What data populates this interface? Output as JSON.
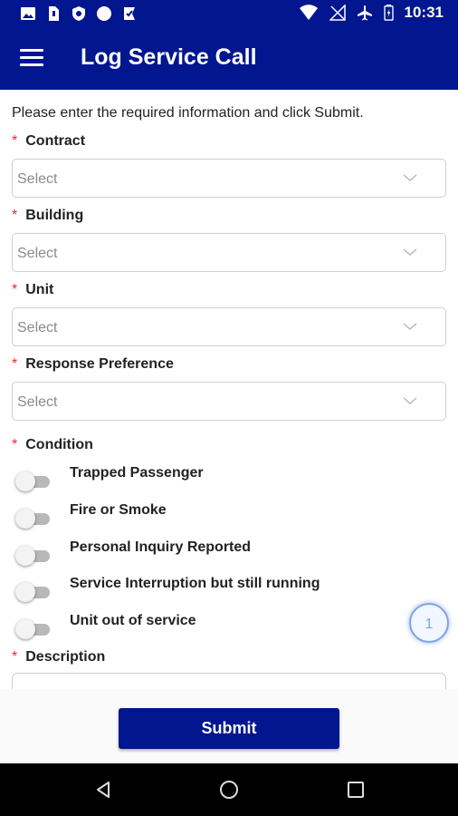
{
  "status_bar": {
    "time": "10:31",
    "left_icons": [
      "image-icon",
      "sim-icon",
      "shield-icon",
      "circle-icon",
      "check-flag-icon"
    ],
    "right_icons": [
      "wifi-icon",
      "signal-off-icon",
      "airplane-icon",
      "battery-icon"
    ]
  },
  "app_bar": {
    "menu_icon": "hamburger-menu-icon",
    "title": "Log Service Call"
  },
  "form": {
    "instruction": "Please enter the required information and click Submit.",
    "required_marker": "*",
    "fields": [
      {
        "label": "Contract",
        "placeholder": "Select"
      },
      {
        "label": "Building",
        "placeholder": "Select"
      },
      {
        "label": "Unit",
        "placeholder": "Select"
      },
      {
        "label": "Response Preference",
        "placeholder": "Select"
      }
    ],
    "condition": {
      "label": "Condition",
      "options": [
        {
          "label": "Trapped Passenger",
          "on": false
        },
        {
          "label": "Fire or Smoke",
          "on": false
        },
        {
          "label": "Personal Inquiry Reported",
          "on": false
        },
        {
          "label": "Service Interruption but still running",
          "on": false
        },
        {
          "label": "Unit out of service",
          "on": false
        }
      ]
    },
    "description": {
      "label": "Description",
      "value": ""
    },
    "floating_badge": "1",
    "submit_label": "Submit"
  },
  "nav_bar": {
    "icons": [
      "back-icon",
      "home-icon",
      "recents-icon"
    ]
  },
  "colors": {
    "primary": "#01168f",
    "required": "#e52b2b",
    "toggle_off_track": "#b8b8b8",
    "badge_accent": "#7da3e6"
  }
}
